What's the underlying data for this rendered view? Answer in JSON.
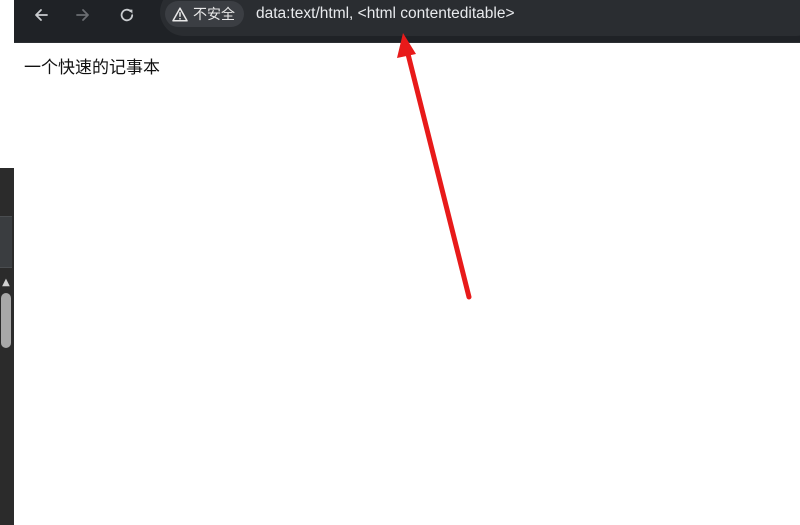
{
  "browser": {
    "nav": {
      "back_icon": "arrow-left-icon",
      "forward_icon": "arrow-right-icon",
      "reload_icon": "reload-icon"
    },
    "security_chip": {
      "icon": "warning-triangle-icon",
      "label": "不安全"
    },
    "address_bar": {
      "url": "data:text/html, <html contenteditable>"
    }
  },
  "page": {
    "text": "一个快速的记事本"
  },
  "annotation": {
    "arrow_color": "#e81a1a",
    "points_to": "address_bar"
  },
  "colors": {
    "toolbar_bg": "#1f2226",
    "omnibox_bg": "#2a2d31",
    "chip_bg": "#3b3e43",
    "url_text": "#e8eaed",
    "page_bg": "#ffffff"
  }
}
